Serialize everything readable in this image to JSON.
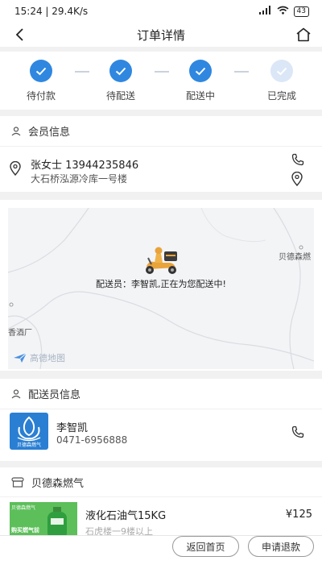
{
  "status_bar": {
    "time_speed": "15:24 | 29.4K/s",
    "signal": "..ıll",
    "battery": "43"
  },
  "nav": {
    "title": "订单详情"
  },
  "progress": {
    "steps": [
      {
        "label": "待付款",
        "done": true
      },
      {
        "label": "待配送",
        "done": true
      },
      {
        "label": "配送中",
        "done": true
      },
      {
        "label": "已完成",
        "done": false
      }
    ]
  },
  "member": {
    "section_title": "会员信息",
    "name_phone": "张女士 13944235846",
    "address": "大石桥泓源冷库一号楼"
  },
  "map": {
    "courier_message": "配送员：李智凯,正在为您配送中!",
    "place_1": "贝德森燃",
    "place_2": "香酒厂",
    "provider": "高德地图"
  },
  "courier": {
    "section_title": "配送员信息",
    "name": "李智凯",
    "phone": "0471-6956888",
    "logo_caption": "贝德森燃气"
  },
  "store": {
    "section_title": "贝德森燃气",
    "product_name": "液化石油气15KG",
    "product_sub": "石虎楼一9楼以上",
    "price": "¥125",
    "thumb_top": "贝德森燃气",
    "thumb_bottom": "购买燃气前"
  },
  "actions": {
    "home": "返回首页",
    "refund": "申请退款"
  },
  "colors": {
    "accent": "#2f87e0",
    "bg_gap": "#f1f1f1"
  }
}
